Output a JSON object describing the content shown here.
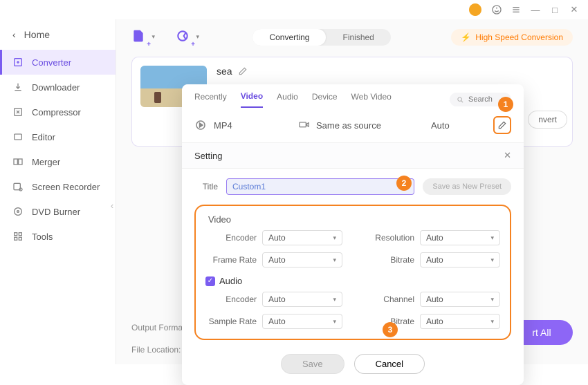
{
  "titlebar": {
    "min": "—",
    "max": "□",
    "close": "✕"
  },
  "home_label": "Home",
  "sidebar": {
    "items": [
      {
        "label": "Converter"
      },
      {
        "label": "Downloader"
      },
      {
        "label": "Compressor"
      },
      {
        "label": "Editor"
      },
      {
        "label": "Merger"
      },
      {
        "label": "Screen Recorder"
      },
      {
        "label": "DVD Burner"
      },
      {
        "label": "Tools"
      }
    ]
  },
  "segment": {
    "converting": "Converting",
    "finished": "Finished"
  },
  "hs_label": "High Speed Conversion",
  "card": {
    "title": "sea"
  },
  "panel": {
    "tabs": {
      "recently": "Recently",
      "video": "Video",
      "audio": "Audio",
      "device": "Device",
      "web": "Web Video"
    },
    "search_placeholder": "Search",
    "format_name": "MP4",
    "same_as_source": "Same as source",
    "auto_label": "Auto",
    "setting_header": "Setting",
    "title_label": "Title",
    "title_value": "Custom1",
    "save_preset": "Save as New Preset",
    "video_group": "Video",
    "audio_group": "Audio",
    "labels": {
      "encoder": "Encoder",
      "resolution": "Resolution",
      "frame_rate": "Frame Rate",
      "bitrate": "Bitrate",
      "sample_rate": "Sample Rate",
      "channel": "Channel"
    },
    "auto": "Auto",
    "save": "Save",
    "cancel": "Cancel"
  },
  "footer": {
    "output_format": "Output Format:",
    "file_location": "File Location:"
  },
  "convert_peek": "nvert",
  "convert_all": "rt All",
  "callouts": {
    "one": "1",
    "two": "2",
    "three": "3"
  }
}
